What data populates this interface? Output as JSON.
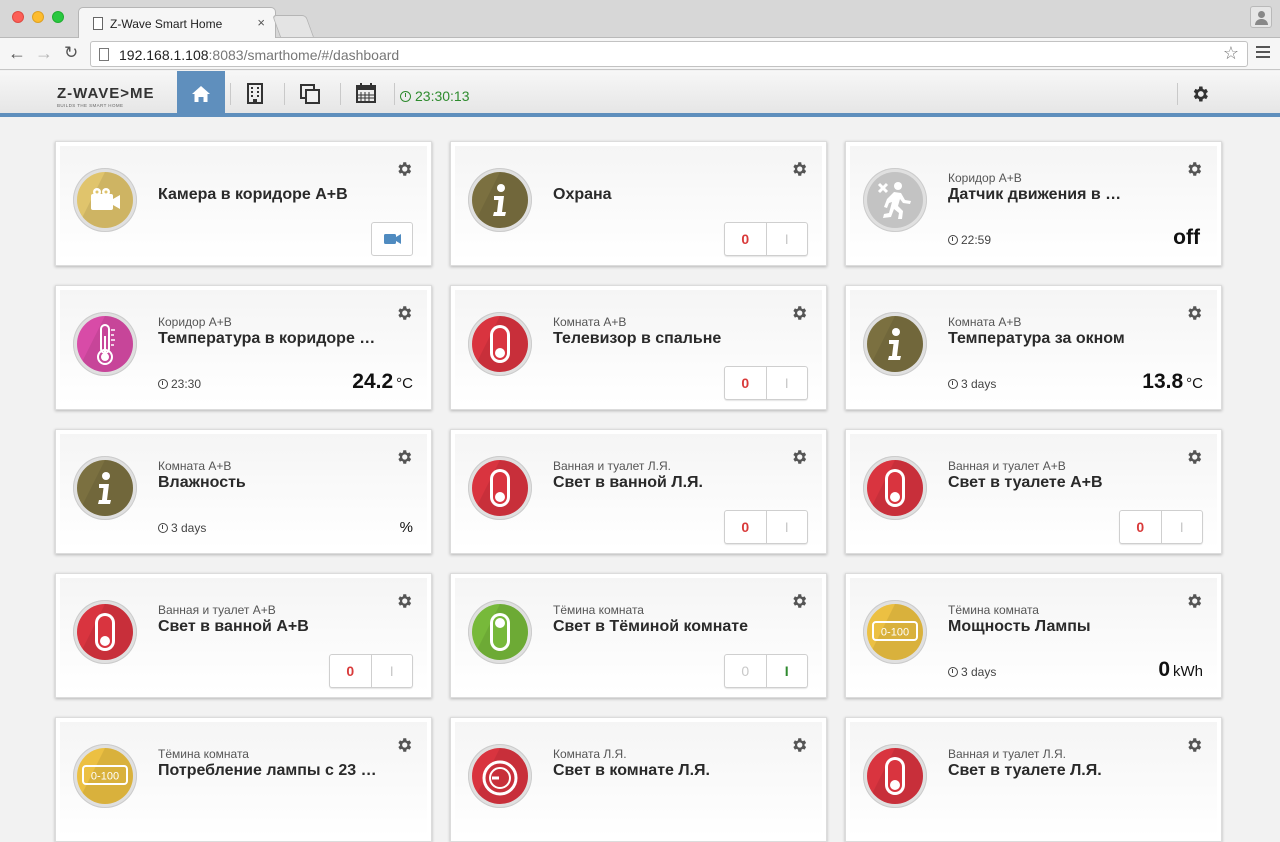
{
  "browser": {
    "tab_title": "Z-Wave Smart Home",
    "tab_close": "×",
    "url_host": "192.168.1.108",
    "url_rest": ":8083/smarthome/#/dashboard",
    "nav_back": "←",
    "nav_forward": "→",
    "nav_reload": "↻",
    "star": "☆"
  },
  "header": {
    "logo_main": "Z-WAVE>ME",
    "logo_sub": "BUILDS THE SMART HOME",
    "clock": "23:30:13",
    "active_color": "#5f8fbd"
  },
  "cards": [
    {
      "location": "",
      "title": "Камера в коридоре A+B",
      "icon": "camera-icon",
      "control": "camera"
    },
    {
      "location": "",
      "title": "Охрана",
      "icon": "info-icon",
      "control": "switch",
      "off_label": "0",
      "on_label": "I",
      "state": "off"
    },
    {
      "location": "Коридор A+B",
      "title": "Датчик движения в …",
      "icon": "motion-sensor-icon",
      "control": "value",
      "updated": "22:59",
      "value": "off",
      "unit": ""
    },
    {
      "location": "Коридор A+B",
      "title": "Температура в коридоре …",
      "icon": "thermometer-icon",
      "control": "value",
      "updated": "23:30",
      "value": "24.2",
      "unit": "°C"
    },
    {
      "location": "Комната A+B",
      "title": "Телевизор в спальне",
      "icon": "switch-off-icon",
      "control": "switch",
      "off_label": "0",
      "on_label": "I",
      "state": "off"
    },
    {
      "location": "Комната A+B",
      "title": "Температура за окном",
      "icon": "info-icon",
      "control": "value",
      "updated": "3 days",
      "value": "13.8",
      "unit": "°C"
    },
    {
      "location": "Комната A+B",
      "title": "Влажность",
      "icon": "info-icon",
      "control": "value",
      "updated": "3 days",
      "value": "",
      "unit": "%"
    },
    {
      "location": "Ванная и туалет Л.Я.",
      "title": "Свет в ванной Л.Я.",
      "icon": "switch-off-icon",
      "control": "switch",
      "off_label": "0",
      "on_label": "I",
      "state": "off"
    },
    {
      "location": "Ванная и туалет A+B",
      "title": "Свет в туалете A+B",
      "icon": "switch-off-icon",
      "control": "switch",
      "off_label": "0",
      "on_label": "I",
      "state": "off"
    },
    {
      "location": "Ванная и туалет A+B",
      "title": "Свет в ванной A+B",
      "icon": "switch-off-icon",
      "control": "switch",
      "off_label": "0",
      "on_label": "I",
      "state": "off"
    },
    {
      "location": "Тёмина комната",
      "title": "Свет в Тёминой комнате",
      "icon": "switch-on-icon",
      "control": "switch",
      "off_label": "0",
      "on_label": "I",
      "state": "on"
    },
    {
      "location": "Тёмина комната",
      "title": "Мощность Лампы",
      "icon": "meter-icon",
      "icon_text": "0-100",
      "control": "value",
      "updated": "3 days",
      "value": "0",
      "unit": "kWh"
    },
    {
      "location": "Тёмина комната",
      "title": "Потребление лампы с 23 …",
      "icon": "meter-icon",
      "icon_text": "0-100",
      "control": "none"
    },
    {
      "location": "Комната Л.Я.",
      "title": "Свет в комнате Л.Я.",
      "icon": "dimmer-icon",
      "control": "none"
    },
    {
      "location": "Ванная и туалет Л.Я.",
      "title": "Свет в туалете Л.Я.",
      "icon": "switch-off-icon",
      "control": "none"
    }
  ]
}
